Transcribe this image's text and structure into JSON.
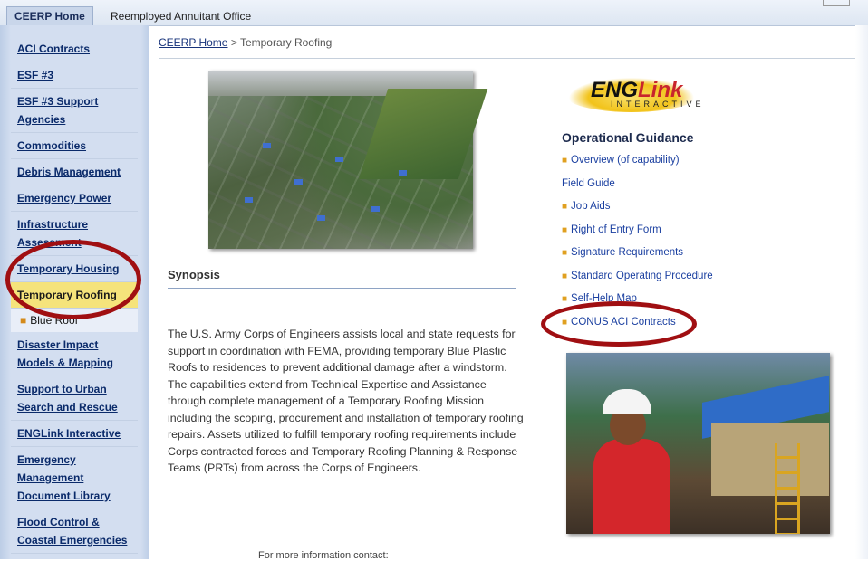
{
  "tabs": [
    {
      "label": "CEERP Home",
      "active": true
    },
    {
      "label": "Reemployed Annuitant Office",
      "active": false
    }
  ],
  "sidebar": {
    "items": [
      {
        "label": "ACI Contracts"
      },
      {
        "label": "ESF #3"
      },
      {
        "label": "ESF #3 Support Agencies"
      },
      {
        "label": "Commodities"
      },
      {
        "label": "Debris Management"
      },
      {
        "label": "Emergency Power"
      },
      {
        "label": "Infrastructure Assessment"
      },
      {
        "label": "Temporary Housing"
      },
      {
        "label": "Temporary Roofing",
        "active": true
      },
      {
        "label": "Blue Roof",
        "sub": true
      },
      {
        "label": "Disaster Impact Models & Mapping"
      },
      {
        "label": "Support to Urban Search and Rescue"
      },
      {
        "label": "ENGLink Interactive"
      },
      {
        "label": "Emergency Management Document Library"
      },
      {
        "label": "Flood Control & Coastal Emergencies"
      }
    ]
  },
  "breadcrumb": {
    "home": "CEERP Home",
    "separator": " > ",
    "current": "Temporary Roofing"
  },
  "synopsis": {
    "heading": "Synopsis",
    "text": "The U.S. Army Corps of Engineers assists local and state requests for support in coordination with FEMA, providing temporary Blue Plastic Roofs to residences to prevent additional damage after a windstorm.  The capabilities extend from Technical Expertise and Assistance through complete management of a Temporary Roofing Mission including the scoping, procurement and installation of temporary roofing repairs. Assets utilized to fulfill temporary roofing requirements include Corps contracted forces and Temporary Roofing Planning & Response Teams (PRTs) from across the Corps of Engineers."
  },
  "contact": "For more information contact:",
  "logo": {
    "eng": "ENG",
    "link": "Link",
    "sub": "INTERACTIVE"
  },
  "guidance": {
    "heading": "Operational Guidance",
    "items": [
      {
        "label": "Overview (of capability)",
        "bullet": true
      },
      {
        "label": "Field Guide",
        "bullet": false
      },
      {
        "label": "Job Aids",
        "bullet": true
      },
      {
        "label": "Right of Entry Form",
        "bullet": true
      },
      {
        "label": "Signature Requirements",
        "bullet": true
      },
      {
        "label": "Standard Operating Procedure",
        "bullet": true
      },
      {
        "label": "Self-Help Map",
        "bullet": true
      },
      {
        "label": "CONUS ACI Contracts",
        "bullet": true
      }
    ]
  },
  "colors": {
    "annotation": "#a00f12",
    "nav_active": "#f5e37b",
    "sidebar_bg": "#d3def0"
  }
}
